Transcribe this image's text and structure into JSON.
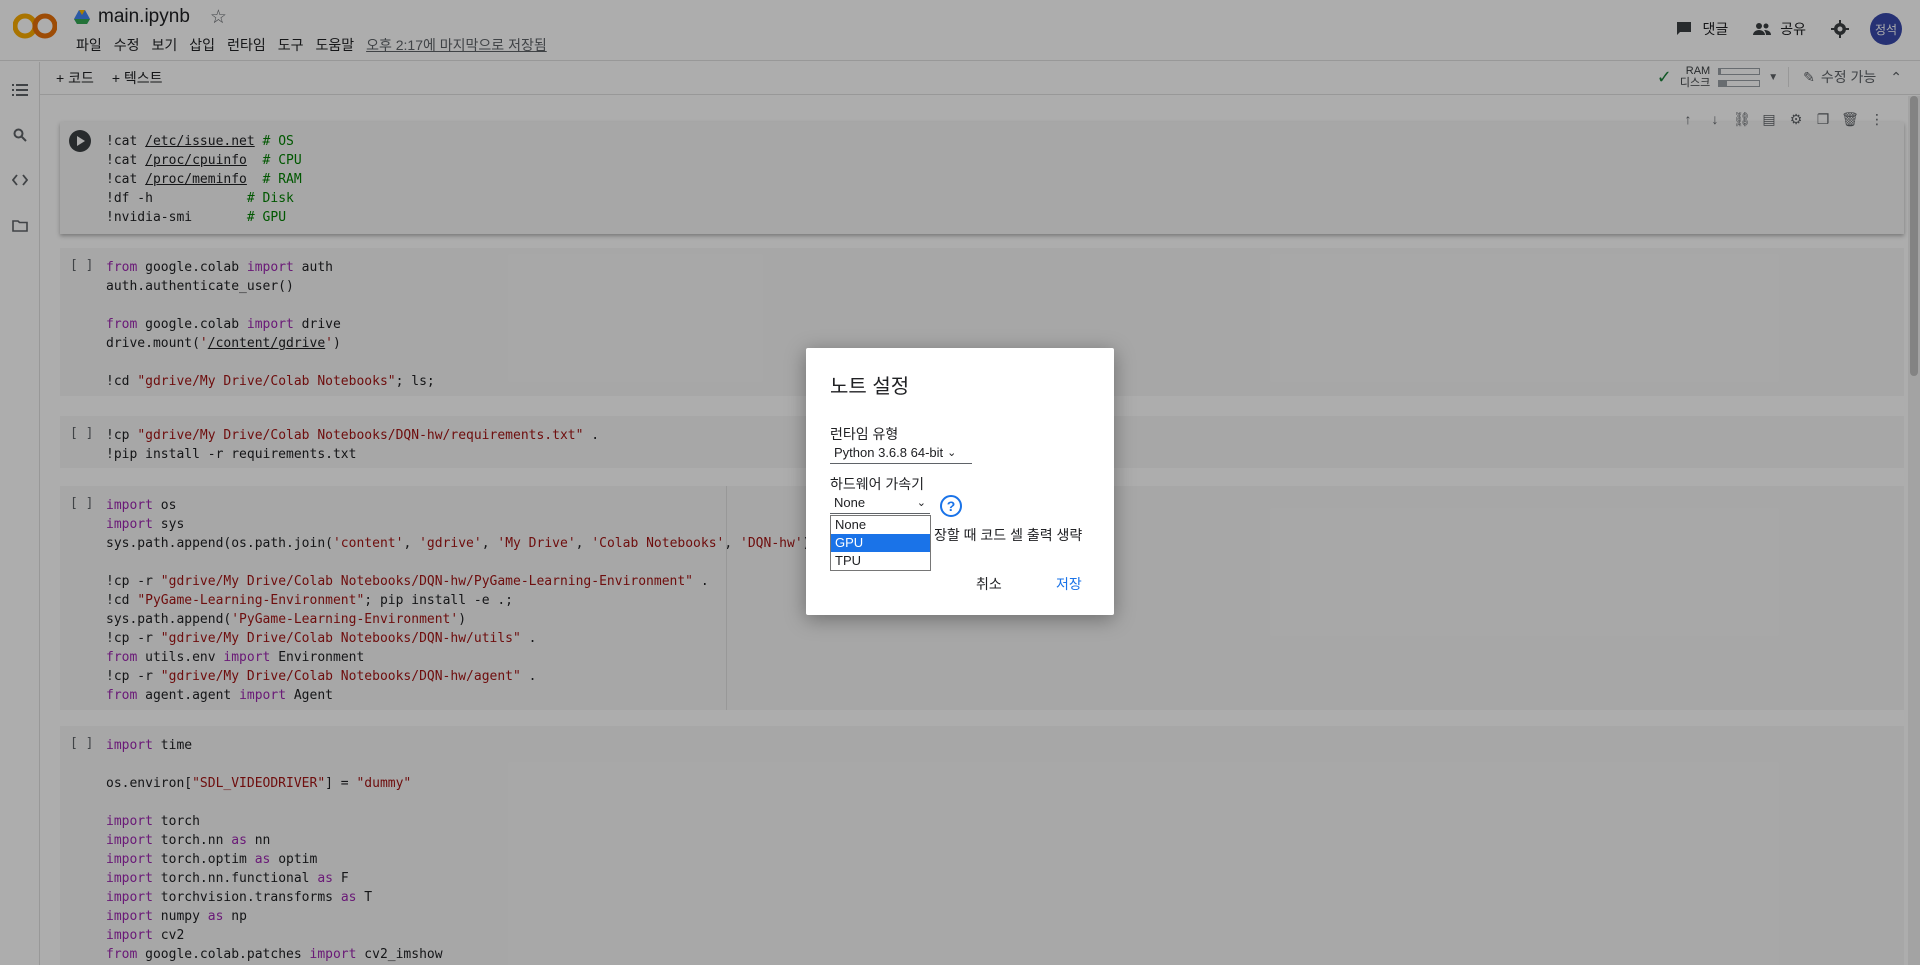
{
  "header": {
    "title": "main.ipynb",
    "menus": [
      "파일",
      "수정",
      "보기",
      "삽입",
      "런타임",
      "도구",
      "도움말"
    ],
    "last_saved": "오후 2:17에 마지막으로 저장됨",
    "comments_label": "댓글",
    "share_label": "공유",
    "avatar_text": "정석"
  },
  "toolbar": {
    "add_code": "+ 코드",
    "add_text": "+ 텍스트",
    "ram_label": "RAM",
    "disk_label": "디스크",
    "ram_usage": 0.05,
    "disk_usage": 0.2,
    "editable_label": "수정 가능"
  },
  "cells": [
    {
      "bracket": "",
      "lines": [
        [
          [
            "",
            "!cat "
          ],
          [
            "ul",
            "/etc/issue.net"
          ],
          [
            "",
            " "
          ],
          [
            "cm",
            "# OS"
          ]
        ],
        [
          [
            "",
            "!cat "
          ],
          [
            "ul",
            "/proc/cpuinfo"
          ],
          [
            "",
            "  "
          ],
          [
            "cm",
            "# CPU"
          ]
        ],
        [
          [
            "",
            "!cat "
          ],
          [
            "ul",
            "/proc/meminfo"
          ],
          [
            "",
            "  "
          ],
          [
            "cm",
            "# RAM"
          ]
        ],
        [
          [
            "",
            "!df -h            "
          ],
          [
            "cm",
            "# Disk"
          ]
        ],
        [
          [
            "",
            "!nvidia-smi       "
          ],
          [
            "cm",
            "# GPU"
          ]
        ]
      ]
    },
    {
      "bracket": "[ ]",
      "lines": [
        [
          [
            "kw",
            "from"
          ],
          [
            "",
            " google.colab "
          ],
          [
            "kw",
            "import"
          ],
          [
            "",
            " auth"
          ]
        ],
        [
          [
            "",
            "auth.authenticate_user()"
          ]
        ],
        [
          [
            "",
            ""
          ]
        ],
        [
          [
            "kw",
            "from"
          ],
          [
            "",
            " google.colab "
          ],
          [
            "kw",
            "import"
          ],
          [
            "",
            " drive"
          ]
        ],
        [
          [
            "",
            "drive.mount("
          ],
          [
            "str",
            "'"
          ],
          [
            "ul",
            "/content/gdrive"
          ],
          [
            "str",
            "'"
          ],
          [
            "",
            ")"
          ]
        ],
        [
          [
            "",
            ""
          ]
        ],
        [
          [
            "",
            "!cd "
          ],
          [
            "str",
            "\"gdrive/My Drive/Colab Notebooks\""
          ],
          [
            "",
            "; ls;"
          ]
        ]
      ]
    },
    {
      "bracket": "[ ]",
      "lines": [
        [
          [
            "",
            "!cp "
          ],
          [
            "str",
            "\"gdrive/My Drive/Colab Notebooks/DQN-hw/requirements.txt\""
          ],
          [
            "",
            " ."
          ]
        ],
        [
          [
            "",
            "!pip install -r requirements.txt"
          ]
        ]
      ]
    },
    {
      "bracket": "[ ]",
      "lines": [
        [
          [
            "kw",
            "import"
          ],
          [
            "",
            " os"
          ]
        ],
        [
          [
            "kw",
            "import"
          ],
          [
            "",
            " sys"
          ]
        ],
        [
          [
            "",
            "sys.path.append(os.path.join("
          ],
          [
            "str",
            "'content'"
          ],
          [
            "",
            ", "
          ],
          [
            "str",
            "'gdrive'"
          ],
          [
            "",
            ", "
          ],
          [
            "str",
            "'My Drive'"
          ],
          [
            "",
            ", "
          ],
          [
            "str",
            "'Colab Notebooks'"
          ],
          [
            "",
            ", "
          ],
          [
            "str",
            "'DQN-hw'"
          ],
          [
            "",
            "))"
          ]
        ],
        [
          [
            "",
            ""
          ]
        ],
        [
          [
            "",
            "!cp -r "
          ],
          [
            "str",
            "\"gdrive/My Drive/Colab Notebooks/DQN-hw/PyGame-Learning-Environment\""
          ],
          [
            "",
            " ."
          ]
        ],
        [
          [
            "",
            "!cd "
          ],
          [
            "str",
            "\"PyGame-Learning-Environment\""
          ],
          [
            "",
            "; pip install -e .;"
          ]
        ],
        [
          [
            "",
            "sys.path.append("
          ],
          [
            "str",
            "'PyGame-Learning-Environment'"
          ],
          [
            "",
            ")"
          ]
        ],
        [
          [
            "",
            "!cp -r "
          ],
          [
            "str",
            "\"gdrive/My Drive/Colab Notebooks/DQN-hw/utils\""
          ],
          [
            "",
            " ."
          ]
        ],
        [
          [
            "kw",
            "from"
          ],
          [
            "",
            " utils.env "
          ],
          [
            "kw",
            "import"
          ],
          [
            "",
            " Environment"
          ]
        ],
        [
          [
            "",
            "!cp -r "
          ],
          [
            "str",
            "\"gdrive/My Drive/Colab Notebooks/DQN-hw/agent\""
          ],
          [
            "",
            " ."
          ]
        ],
        [
          [
            "kw",
            "from"
          ],
          [
            "",
            " agent.agent "
          ],
          [
            "kw",
            "import"
          ],
          [
            "",
            " Agent"
          ]
        ]
      ]
    },
    {
      "bracket": "[ ]",
      "lines": [
        [
          [
            "kw",
            "import"
          ],
          [
            "",
            " time"
          ]
        ],
        [
          [
            "",
            ""
          ]
        ],
        [
          [
            "",
            "os.environ["
          ],
          [
            "str",
            "\"SDL_VIDEODRIVER\""
          ],
          [
            "",
            "] = "
          ],
          [
            "str",
            "\"dummy\""
          ]
        ],
        [
          [
            "",
            ""
          ]
        ],
        [
          [
            "kw",
            "import"
          ],
          [
            "",
            " torch"
          ]
        ],
        [
          [
            "kw",
            "import"
          ],
          [
            "",
            " torch.nn "
          ],
          [
            "kw",
            "as"
          ],
          [
            "",
            " nn"
          ]
        ],
        [
          [
            "kw",
            "import"
          ],
          [
            "",
            " torch.optim "
          ],
          [
            "kw",
            "as"
          ],
          [
            "",
            " optim"
          ]
        ],
        [
          [
            "kw",
            "import"
          ],
          [
            "",
            " torch.nn.functional "
          ],
          [
            "kw",
            "as"
          ],
          [
            "",
            " F"
          ]
        ],
        [
          [
            "kw",
            "import"
          ],
          [
            "",
            " torchvision.transforms "
          ],
          [
            "kw",
            "as"
          ],
          [
            "",
            " T"
          ]
        ],
        [
          [
            "kw",
            "import"
          ],
          [
            "",
            " numpy "
          ],
          [
            "kw",
            "as"
          ],
          [
            "",
            " np"
          ]
        ],
        [
          [
            "kw",
            "import"
          ],
          [
            "",
            " cv2"
          ]
        ],
        [
          [
            "kw",
            "from"
          ],
          [
            "",
            " google.colab.patches "
          ],
          [
            "kw",
            "import"
          ],
          [
            "",
            " cv2_imshow"
          ]
        ]
      ]
    }
  ],
  "dialog": {
    "title": "노트 설정",
    "runtime_label": "런타임 유형",
    "runtime_value": "Python 3.6.8 64-bit",
    "accelerator_label": "하드웨어 가속기",
    "accelerator_value": "None",
    "accelerator_options": [
      "None",
      "GPU",
      "TPU"
    ],
    "highlighted_option": "GPU",
    "omit_output_text": "장할 때 코드 셀 출력 생략",
    "cancel_label": "취소",
    "save_label": "저장"
  },
  "colors": {
    "accent": "#1a73e8",
    "keyword": "#9c27b0",
    "string": "#a31515",
    "comment": "#008000"
  }
}
